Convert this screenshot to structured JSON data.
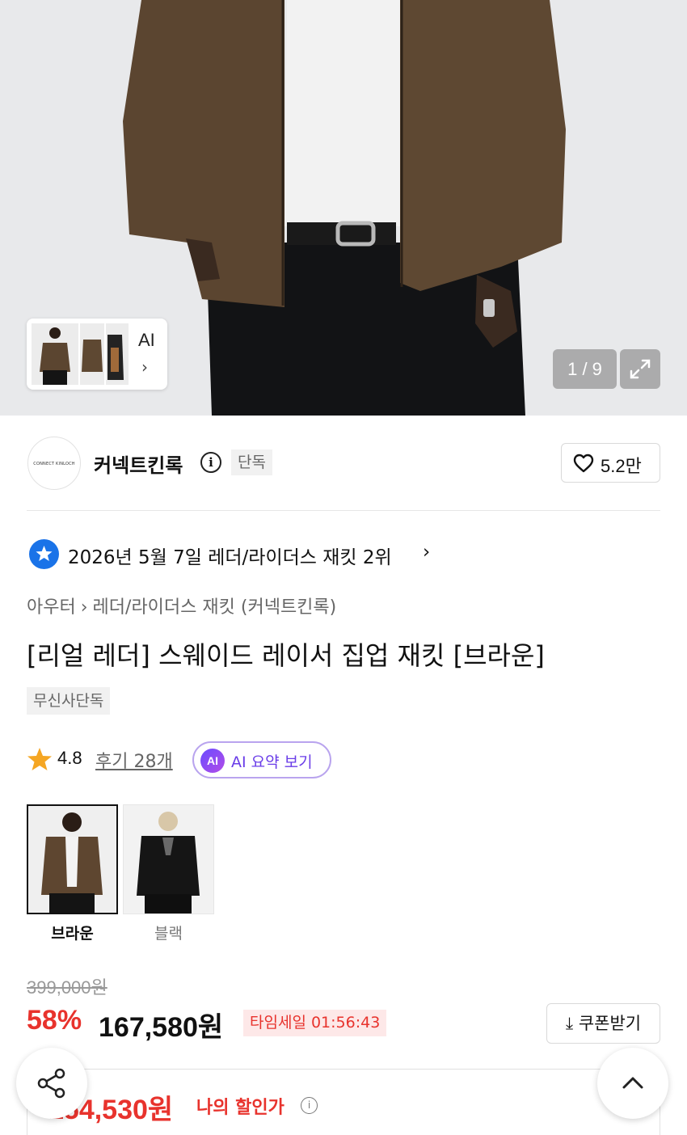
{
  "gallery": {
    "thumb_ai_label": "AI",
    "thumb_chevron": "›",
    "counter": "1 / 9",
    "expand_icon": "expand-icon"
  },
  "brand": {
    "logo_text": "CONNECT KINLOCH",
    "name": "커넥트킨록",
    "exclusive_tag": "단독",
    "likes": "5.2만"
  },
  "ranking": {
    "text": "2026년 5월 7일 레더/라이더스 재킷 2위",
    "chevron": "›"
  },
  "breadcrumb": {
    "level1": "아우터",
    "separator": "›",
    "level2": "레더/라이더스 재킷",
    "brand": "(커넥트킨록)"
  },
  "product": {
    "title": "[리얼 레더] 스웨이드 레이서 집업 재킷 [브라운]",
    "tag": "무신사단독",
    "rating": "4.8",
    "reviews": "후기 28개",
    "ai_badge": "AI",
    "ai_summary": "AI 요약 보기"
  },
  "colors": [
    {
      "label": "브라운",
      "selected": true
    },
    {
      "label": "블랙",
      "selected": false
    }
  ],
  "price": {
    "original": "399,000원",
    "discount": "58%",
    "sale": "167,580원",
    "timesale": "타임세일 01:56:43",
    "coupon": "⤓ 쿠폰받기",
    "my_price": "154,530원",
    "my_price_label": "나의 할인가",
    "my_price_info": "i"
  },
  "accent": {
    "red": "#e8332d",
    "purple": "#6a3de8",
    "blue": "#1a73e8",
    "star": "#f5a623"
  }
}
